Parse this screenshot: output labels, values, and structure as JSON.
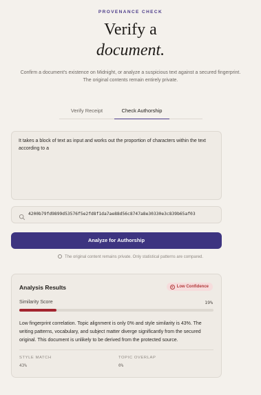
{
  "header": {
    "eyebrow": "PROVENANCE CHECK",
    "title_line1": "Verify a",
    "title_line2": "document.",
    "subtitle": "Confirm a document's existence on Midnight, or analyze a suspicious text against a secured fingerprint. The original contents remain entirely private."
  },
  "tabs": [
    {
      "label": "Verify Receipt",
      "active": false
    },
    {
      "label": "Check Authorship",
      "active": true
    }
  ],
  "accent_color": "#3d3480",
  "text_input": {
    "value": "It takes a block of text as input and works out the proportion of characters within the text according to a"
  },
  "hash_input": {
    "icon": "search-icon",
    "value": "4200b79fd9899d53576f5e2fd8f1da7ae88d56c8747a8e30330e3c839b65af03"
  },
  "analyze_button": {
    "label": "Analyze for Authorship"
  },
  "privacy_note": "The original content remains private. Only statistical patterns are compared.",
  "results": {
    "title": "Analysis Results",
    "badge": {
      "label": "Low Confidence",
      "color": "#b13a3a"
    },
    "similarity_label": "Similarity Score",
    "similarity_value": "19%",
    "similarity_fraction": 0.19,
    "bar_color": "#a3252f",
    "description": "Low fingerprint correlation. Topic alignment is only 0% and style similarity is 43%. The writing patterns, vocabulary, and subject matter diverge significantly from the secured original. This document is unlikely to be derived from the protected source.",
    "stats": [
      {
        "label": "STYLE MATCH",
        "value": "43%"
      },
      {
        "label": "TOPIC OVERLAP",
        "value": "0%"
      }
    ]
  }
}
